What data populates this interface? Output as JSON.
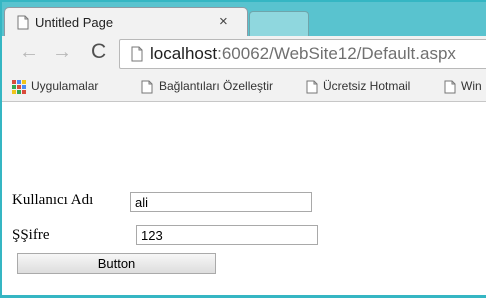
{
  "browser": {
    "tab": {
      "title": "Untitled Page",
      "close_glyph": "×"
    },
    "navigation": {
      "back_glyph": "←",
      "forward_glyph": "→",
      "reload_glyph": "C"
    },
    "address": {
      "host": "localhost",
      "path": ":60062/WebSite12/Default.aspx"
    },
    "bookmarks": {
      "items": [
        "Uygulamalar",
        "Bağlantıları Özelleştir",
        "Ücretsiz Hotmail",
        "Win"
      ]
    }
  },
  "page": {
    "username": {
      "label": "Kullanıcı Adı",
      "value": "ali"
    },
    "password": {
      "label": "ŞŞifre",
      "value": "123"
    },
    "submit_label": "Button"
  },
  "colors": {
    "tabstrip": "#59c3cf",
    "frame": "#35b6c3",
    "toolbar": "#f2f2f2"
  },
  "icons": {
    "page": "page-icon",
    "apps": "apps-grid-icon",
    "back": "back-arrow-icon",
    "forward": "forward-arrow-icon",
    "reload": "reload-icon",
    "close": "close-icon"
  }
}
